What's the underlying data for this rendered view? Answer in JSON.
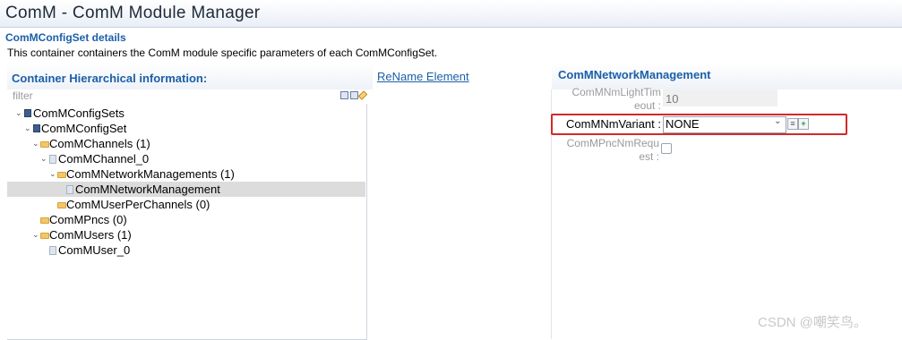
{
  "window": {
    "title": "ComM - ComM Module Manager"
  },
  "section": {
    "title": "ComMConfigSet details",
    "description": "This container containers the ComM module specific parameters of each ComMConfigSet."
  },
  "left_panel": {
    "header": "Container Hierarchical information:",
    "filter_placeholder": "filter",
    "toolbar_icons": [
      "collapse-all-icon",
      "expand-all-icon",
      "edit-icon"
    ],
    "tree": [
      {
        "label": "ComMConfigSets",
        "expanded": true,
        "icon": "module-icon"
      },
      {
        "label": "ComMConfigSet",
        "expanded": true,
        "icon": "module-icon"
      },
      {
        "label": "ComMChannels (1)",
        "expanded": true,
        "icon": "folder-icon"
      },
      {
        "label": "ComMChannel_0",
        "expanded": true,
        "icon": "element-icon"
      },
      {
        "label": "ComMNetworkManagements (1)",
        "expanded": true,
        "icon": "folder-icon"
      },
      {
        "label": "ComMNetworkManagement",
        "selected": true,
        "icon": "element-icon"
      },
      {
        "label": "ComMUserPerChannels (0)",
        "icon": "folder-icon"
      },
      {
        "label": "ComMPncs (0)",
        "icon": "folder-icon"
      },
      {
        "label": "ComMUsers (1)",
        "expanded": true,
        "icon": "folder-icon"
      },
      {
        "label": "ComMUser_0",
        "icon": "element-icon"
      }
    ]
  },
  "rename_link": "ReName Element",
  "right_panel": {
    "header": "ComMNetworkManagement",
    "fields": {
      "light_timeout": {
        "label_line1": "ComMNmLightTim",
        "label_line2": "eout :",
        "value": "10"
      },
      "nm_variant": {
        "label": "ComMNmVariant :",
        "value": "NONE"
      },
      "pnc_nm_request": {
        "label_line1": "ComMPncNmRequ",
        "label_line2": "est :",
        "checked": false
      }
    }
  },
  "watermark": "CSDN @嘲笑鸟。",
  "colors": {
    "accent": "#1b5fa8",
    "highlight": "#d02a2a",
    "selection": "#dcdcdc"
  }
}
